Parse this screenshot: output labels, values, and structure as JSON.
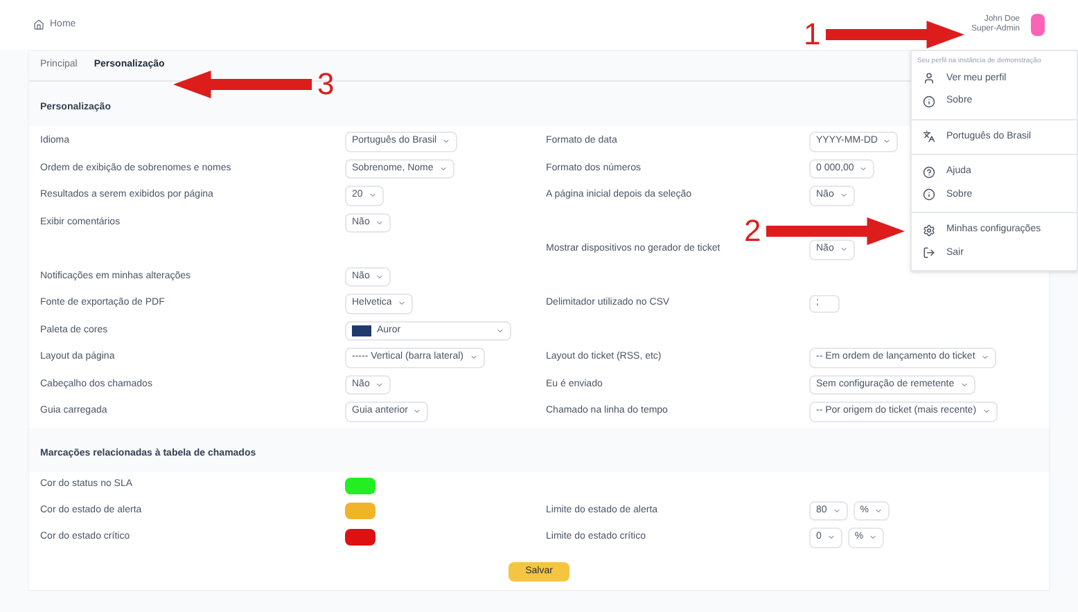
{
  "header": {
    "title": "Home",
    "user_name": "John Doe",
    "user_role": "Super-Admin"
  },
  "tabs": [
    {
      "label": "Principal",
      "selected": false
    },
    {
      "label": "Personalização",
      "selected": true
    }
  ],
  "sections": [
    {
      "title": "Personalização",
      "rows": [
        {
          "left": {
            "label": "Idioma",
            "control": {
              "kind": "select",
              "value": "Português do Brasil"
            }
          },
          "right": {
            "label": "Formato de data",
            "control": {
              "kind": "select",
              "value": "YYYY-MM-DD"
            }
          }
        },
        {
          "left": {
            "label": "Ordem de exibição de sobrenomes e nomes",
            "control": {
              "kind": "select",
              "value": "Sobrenome, Nome"
            }
          },
          "right": {
            "label": "Formato dos números",
            "control": {
              "kind": "select",
              "value": "0 000,00"
            }
          }
        },
        {
          "left": {
            "label": "Resultados a serem exibidos por página",
            "control": {
              "kind": "select",
              "value": "20"
            }
          },
          "right": {
            "label": "A página inicial depois da seleção",
            "control": {
              "kind": "select",
              "value": "Não"
            }
          }
        },
        {
          "left": {
            "label": "Exibir comentários",
            "control": {
              "kind": "select",
              "value": "Não"
            }
          }
        },
        {
          "right": {
            "label": "Mostrar dispositivos no gerador de ticket",
            "control": {
              "kind": "select",
              "value": "Não"
            }
          }
        },
        {
          "left": {
            "label": "Notificações em minhas alterações",
            "control": {
              "kind": "select",
              "value": "Não"
            }
          }
        },
        {
          "left": {
            "label": "Fonte de exportação de PDF",
            "control": {
              "kind": "select",
              "value": "Helvetica"
            }
          },
          "right": {
            "label": "Delimitador utilizado no CSV",
            "control": {
              "kind": "input",
              "value": ";"
            }
          }
        },
        {
          "left": {
            "label": "Paleta de cores",
            "control": {
              "kind": "palette",
              "value": "Auror",
              "color": "#1e3a6e"
            }
          }
        },
        {
          "left": {
            "label": "Layout da página",
            "control": {
              "kind": "select",
              "value": "----- Vertical (barra lateral)"
            }
          },
          "right": {
            "label": "Layout do ticket (RSS, etc)",
            "control": {
              "kind": "select",
              "value": "-- Em ordem de lançamento do ticket"
            }
          }
        },
        {
          "left": {
            "label": "Cabeçalho dos chamados",
            "control": {
              "kind": "select",
              "value": "Não"
            }
          },
          "right": {
            "label": "Eu é enviado",
            "control": {
              "kind": "select",
              "value": "Sem configuração de remetente"
            }
          }
        },
        {
          "left": {
            "label": "Guia carregada",
            "control": {
              "kind": "select",
              "value": "Guia anterior"
            }
          },
          "right": {
            "label": "Chamado na linha do tempo",
            "control": {
              "kind": "select",
              "value": "-- Por origem do ticket (mais recente)"
            }
          }
        }
      ]
    },
    {
      "title": "Marcações relacionadas à tabela de chamados",
      "rows": [
        {
          "left": {
            "label": "Cor do status no SLA",
            "control": {
              "kind": "color",
              "color": "#22ee22"
            }
          }
        },
        {
          "left": {
            "label": "Cor do estado de alerta",
            "control": {
              "kind": "color",
              "color": "#f0b429"
            }
          },
          "right": {
            "label": "Limite do estado de alerta",
            "control": {
              "kind": "pair",
              "values": [
                "80",
                "%"
              ]
            }
          }
        },
        {
          "left": {
            "label": "Cor do estado crítico",
            "control": {
              "kind": "color",
              "color": "#dd1111"
            }
          },
          "right": {
            "label": "Limite do estado crítico",
            "control": {
              "kind": "pair",
              "values": [
                "0",
                "%"
              ]
            }
          }
        }
      ]
    }
  ],
  "save_button": "Salvar",
  "menu": {
    "caption": "Seu perfil na instância de demonstração",
    "groups": [
      [
        {
          "kind": "user",
          "label": "Ver meu perfil"
        },
        {
          "kind": "info",
          "label": "Sobre"
        }
      ],
      [
        {
          "kind": "language",
          "label": "Português do Brasil"
        }
      ],
      [
        {
          "kind": "help",
          "label": "Ajuda"
        },
        {
          "kind": "info",
          "label": "Sobre"
        }
      ],
      [
        {
          "kind": "settings",
          "label": "Minhas configurações"
        },
        {
          "kind": "logout",
          "label": "Sair"
        }
      ]
    ]
  },
  "annotations": [
    {
      "number": "1",
      "points_left": false
    },
    {
      "number": "2",
      "points_left": false
    },
    {
      "number": "3",
      "points_left": true
    }
  ]
}
